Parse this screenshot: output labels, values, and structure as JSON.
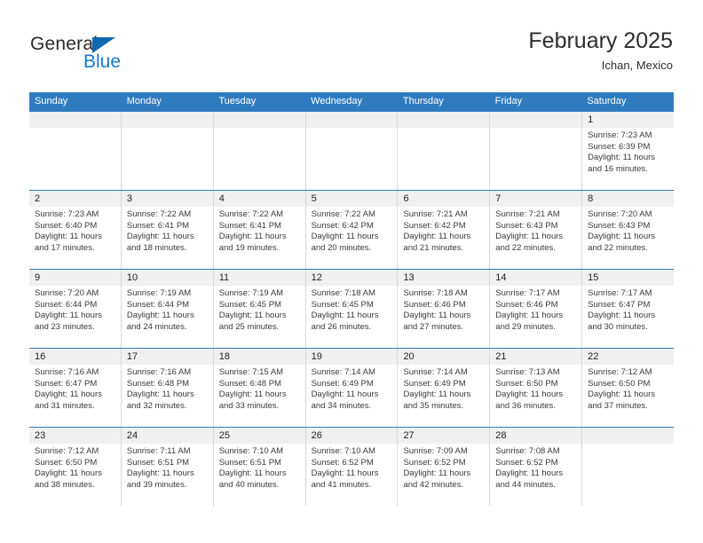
{
  "brand": {
    "name_part1": "General",
    "name_part2": "Blue",
    "accent_color": "#1877c9",
    "header_color": "#2f7bc0"
  },
  "header": {
    "title": "February 2025",
    "subtitle": "Ichan, Mexico"
  },
  "calendar": {
    "day_headers": [
      "Sunday",
      "Monday",
      "Tuesday",
      "Wednesday",
      "Thursday",
      "Friday",
      "Saturday"
    ],
    "weeks": [
      [
        {
          "day": "",
          "sunrise": "",
          "sunset": "",
          "daylight": ""
        },
        {
          "day": "",
          "sunrise": "",
          "sunset": "",
          "daylight": ""
        },
        {
          "day": "",
          "sunrise": "",
          "sunset": "",
          "daylight": ""
        },
        {
          "day": "",
          "sunrise": "",
          "sunset": "",
          "daylight": ""
        },
        {
          "day": "",
          "sunrise": "",
          "sunset": "",
          "daylight": ""
        },
        {
          "day": "",
          "sunrise": "",
          "sunset": "",
          "daylight": ""
        },
        {
          "day": "1",
          "sunrise": "Sunrise: 7:23 AM",
          "sunset": "Sunset: 6:39 PM",
          "daylight": "Daylight: 11 hours and 16 minutes."
        }
      ],
      [
        {
          "day": "2",
          "sunrise": "Sunrise: 7:23 AM",
          "sunset": "Sunset: 6:40 PM",
          "daylight": "Daylight: 11 hours and 17 minutes."
        },
        {
          "day": "3",
          "sunrise": "Sunrise: 7:22 AM",
          "sunset": "Sunset: 6:41 PM",
          "daylight": "Daylight: 11 hours and 18 minutes."
        },
        {
          "day": "4",
          "sunrise": "Sunrise: 7:22 AM",
          "sunset": "Sunset: 6:41 PM",
          "daylight": "Daylight: 11 hours and 19 minutes."
        },
        {
          "day": "5",
          "sunrise": "Sunrise: 7:22 AM",
          "sunset": "Sunset: 6:42 PM",
          "daylight": "Daylight: 11 hours and 20 minutes."
        },
        {
          "day": "6",
          "sunrise": "Sunrise: 7:21 AM",
          "sunset": "Sunset: 6:42 PM",
          "daylight": "Daylight: 11 hours and 21 minutes."
        },
        {
          "day": "7",
          "sunrise": "Sunrise: 7:21 AM",
          "sunset": "Sunset: 6:43 PM",
          "daylight": "Daylight: 11 hours and 22 minutes."
        },
        {
          "day": "8",
          "sunrise": "Sunrise: 7:20 AM",
          "sunset": "Sunset: 6:43 PM",
          "daylight": "Daylight: 11 hours and 22 minutes."
        }
      ],
      [
        {
          "day": "9",
          "sunrise": "Sunrise: 7:20 AM",
          "sunset": "Sunset: 6:44 PM",
          "daylight": "Daylight: 11 hours and 23 minutes."
        },
        {
          "day": "10",
          "sunrise": "Sunrise: 7:19 AM",
          "sunset": "Sunset: 6:44 PM",
          "daylight": "Daylight: 11 hours and 24 minutes."
        },
        {
          "day": "11",
          "sunrise": "Sunrise: 7:19 AM",
          "sunset": "Sunset: 6:45 PM",
          "daylight": "Daylight: 11 hours and 25 minutes."
        },
        {
          "day": "12",
          "sunrise": "Sunrise: 7:18 AM",
          "sunset": "Sunset: 6:45 PM",
          "daylight": "Daylight: 11 hours and 26 minutes."
        },
        {
          "day": "13",
          "sunrise": "Sunrise: 7:18 AM",
          "sunset": "Sunset: 6:46 PM",
          "daylight": "Daylight: 11 hours and 27 minutes."
        },
        {
          "day": "14",
          "sunrise": "Sunrise: 7:17 AM",
          "sunset": "Sunset: 6:46 PM",
          "daylight": "Daylight: 11 hours and 29 minutes."
        },
        {
          "day": "15",
          "sunrise": "Sunrise: 7:17 AM",
          "sunset": "Sunset: 6:47 PM",
          "daylight": "Daylight: 11 hours and 30 minutes."
        }
      ],
      [
        {
          "day": "16",
          "sunrise": "Sunrise: 7:16 AM",
          "sunset": "Sunset: 6:47 PM",
          "daylight": "Daylight: 11 hours and 31 minutes."
        },
        {
          "day": "17",
          "sunrise": "Sunrise: 7:16 AM",
          "sunset": "Sunset: 6:48 PM",
          "daylight": "Daylight: 11 hours and 32 minutes."
        },
        {
          "day": "18",
          "sunrise": "Sunrise: 7:15 AM",
          "sunset": "Sunset: 6:48 PM",
          "daylight": "Daylight: 11 hours and 33 minutes."
        },
        {
          "day": "19",
          "sunrise": "Sunrise: 7:14 AM",
          "sunset": "Sunset: 6:49 PM",
          "daylight": "Daylight: 11 hours and 34 minutes."
        },
        {
          "day": "20",
          "sunrise": "Sunrise: 7:14 AM",
          "sunset": "Sunset: 6:49 PM",
          "daylight": "Daylight: 11 hours and 35 minutes."
        },
        {
          "day": "21",
          "sunrise": "Sunrise: 7:13 AM",
          "sunset": "Sunset: 6:50 PM",
          "daylight": "Daylight: 11 hours and 36 minutes."
        },
        {
          "day": "22",
          "sunrise": "Sunrise: 7:12 AM",
          "sunset": "Sunset: 6:50 PM",
          "daylight": "Daylight: 11 hours and 37 minutes."
        }
      ],
      [
        {
          "day": "23",
          "sunrise": "Sunrise: 7:12 AM",
          "sunset": "Sunset: 6:50 PM",
          "daylight": "Daylight: 11 hours and 38 minutes."
        },
        {
          "day": "24",
          "sunrise": "Sunrise: 7:11 AM",
          "sunset": "Sunset: 6:51 PM",
          "daylight": "Daylight: 11 hours and 39 minutes."
        },
        {
          "day": "25",
          "sunrise": "Sunrise: 7:10 AM",
          "sunset": "Sunset: 6:51 PM",
          "daylight": "Daylight: 11 hours and 40 minutes."
        },
        {
          "day": "26",
          "sunrise": "Sunrise: 7:10 AM",
          "sunset": "Sunset: 6:52 PM",
          "daylight": "Daylight: 11 hours and 41 minutes."
        },
        {
          "day": "27",
          "sunrise": "Sunrise: 7:09 AM",
          "sunset": "Sunset: 6:52 PM",
          "daylight": "Daylight: 11 hours and 42 minutes."
        },
        {
          "day": "28",
          "sunrise": "Sunrise: 7:08 AM",
          "sunset": "Sunset: 6:52 PM",
          "daylight": "Daylight: 11 hours and 44 minutes."
        },
        {
          "day": "",
          "sunrise": "",
          "sunset": "",
          "daylight": ""
        }
      ]
    ]
  }
}
